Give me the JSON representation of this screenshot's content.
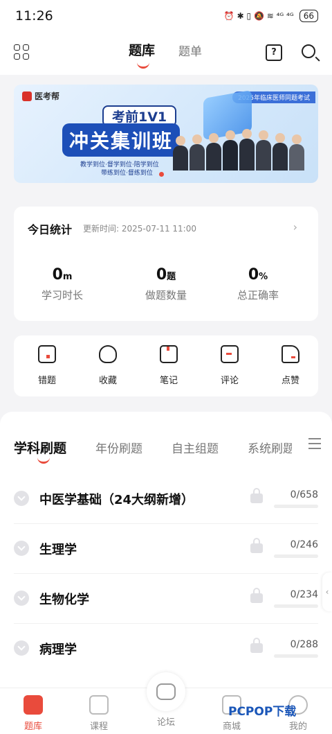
{
  "status": {
    "time": "11:26",
    "icons": "⏰ ✱ ▯ 🔕 ≋ ⁴ᴳ ⁴ᴳ",
    "battery": "66"
  },
  "header": {
    "tabs": [
      {
        "label": "题库"
      },
      {
        "label": "题单"
      }
    ],
    "help_glyph": "?"
  },
  "banner": {
    "brand": "医考帮",
    "badge": "2025年临床医师同题考试",
    "headline": "考前1V1",
    "title": "冲关集训班",
    "subtitle_1": "教学到位·督学到位·陪学到位",
    "subtitle_2": "带练到位·督练到位"
  },
  "stats": {
    "title": "今日统计",
    "update_label": "更新时间: 2025-07-11 11:00",
    "arrow": "›",
    "items": [
      {
        "value": "0",
        "unit": "m",
        "label": "学习时长"
      },
      {
        "value": "0",
        "unit": "题",
        "label": "做题数量"
      },
      {
        "value": "0",
        "unit": "%",
        "label": "总正确率"
      }
    ]
  },
  "actions": [
    {
      "label": "错题",
      "icon": "wrong-question-icon"
    },
    {
      "label": "收藏",
      "icon": "heart-icon"
    },
    {
      "label": "笔记",
      "icon": "bookmark-icon"
    },
    {
      "label": "评论",
      "icon": "comment-icon"
    },
    {
      "label": "点赞",
      "icon": "thumbs-up-icon"
    }
  ],
  "subject_tabs": [
    {
      "label": "学科刷题"
    },
    {
      "label": "年份刷题"
    },
    {
      "label": "自主组题"
    },
    {
      "label": "系统刷题"
    }
  ],
  "subjects": [
    {
      "name": "中医学基础（24大纲新增）",
      "count": "0/658"
    },
    {
      "name": "生理学",
      "count": "0/246"
    },
    {
      "name": "生物化学",
      "count": "0/234"
    },
    {
      "name": "病理学",
      "count": "0/288"
    }
  ],
  "side_handle": "‹",
  "bottom_nav": [
    {
      "label": "题库"
    },
    {
      "label": "课程"
    },
    {
      "label": "论坛"
    },
    {
      "label": "商城"
    },
    {
      "label": "我的"
    }
  ],
  "watermark": "PCPOP下载",
  "colors": {
    "accent": "#e94b3c",
    "banner_blue": "#1d4fb8"
  }
}
